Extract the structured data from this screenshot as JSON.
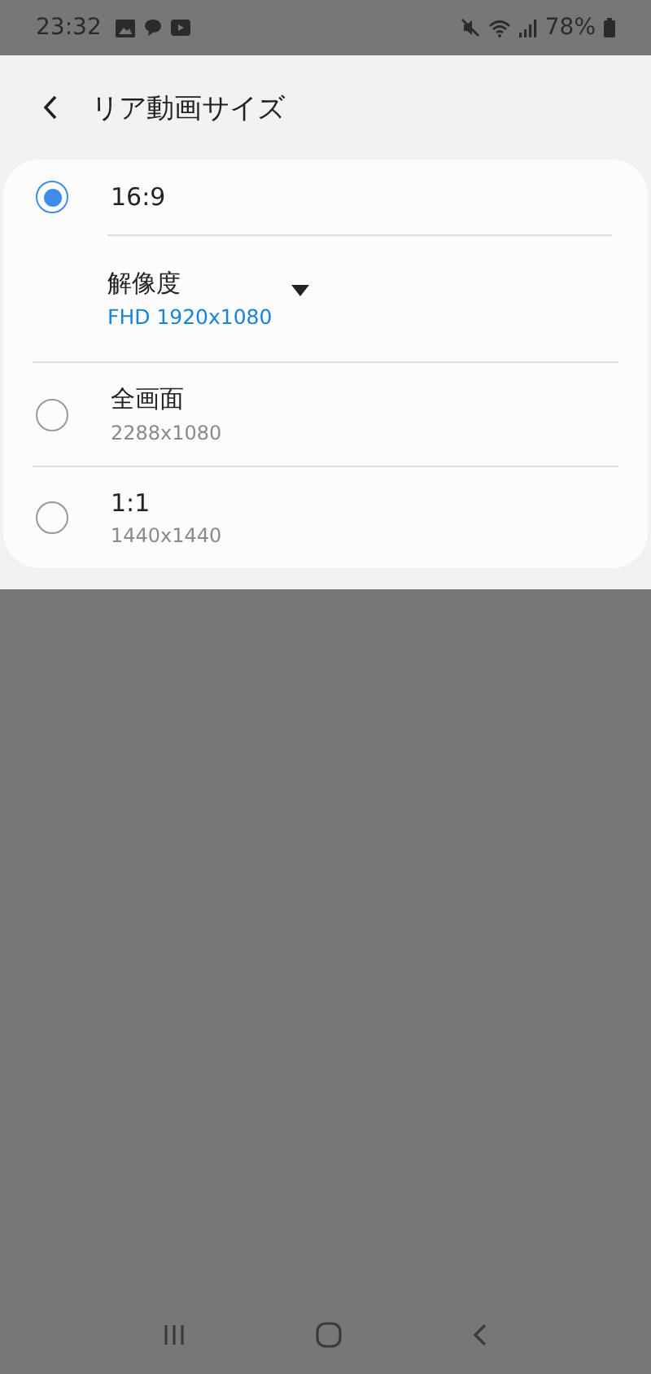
{
  "status_bar": {
    "time": "23:32",
    "battery": "78%"
  },
  "header": {
    "title": "リア動画サイズ"
  },
  "options": [
    {
      "label": "16:9",
      "selected": true,
      "setting": {
        "label": "解像度",
        "value": "FHD 1920x1080"
      }
    },
    {
      "label": "全画面",
      "detail": "2288x1080",
      "selected": false
    },
    {
      "label": "1:1",
      "detail": "1440x1440",
      "selected": false
    }
  ]
}
